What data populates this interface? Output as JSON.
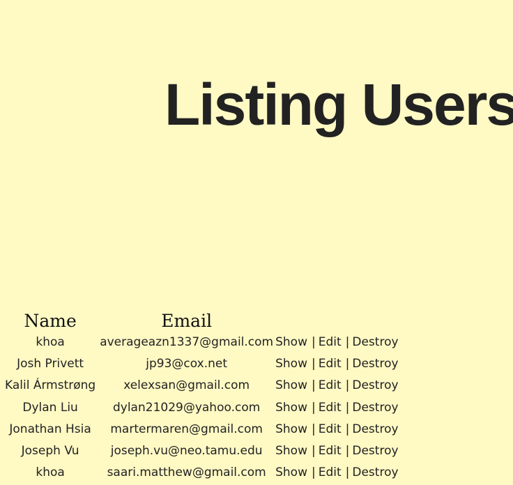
{
  "header": {
    "title": "Listing Users"
  },
  "table": {
    "columns": {
      "name": "Name",
      "email": "Email"
    },
    "actions": {
      "show": "Show",
      "edit": "Edit",
      "destroy": "Destroy",
      "separator": "|"
    },
    "rows": [
      {
        "name": "khoa",
        "email": "averageazn1337@gmail.com"
      },
      {
        "name": "Josh Privett",
        "email": "jp93@cox.net"
      },
      {
        "name": "Kalil Ármstrøng",
        "email": "xelexsan@gmail.com"
      },
      {
        "name": "Dylan Liu",
        "email": "dylan21029@yahoo.com"
      },
      {
        "name": "Jonathan Hsia",
        "email": "martermaren@gmail.com"
      },
      {
        "name": "Joseph Vu",
        "email": "joseph.vu@neo.tamu.edu"
      },
      {
        "name": "khoa",
        "email": "saari.matthew@gmail.com"
      }
    ]
  }
}
